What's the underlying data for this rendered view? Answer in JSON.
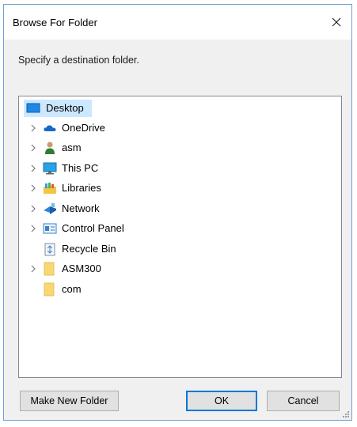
{
  "window": {
    "title": "Browse For Folder",
    "close_glyph": "✕"
  },
  "instruction": "Specify a destination folder.",
  "tree": {
    "items": [
      {
        "label": "Desktop",
        "icon": "desktop-icon",
        "expandable": false,
        "selected": true,
        "level": 0
      },
      {
        "label": "OneDrive",
        "icon": "onedrive-cloud-icon",
        "expandable": true,
        "level": 1
      },
      {
        "label": "asm",
        "icon": "user-icon",
        "expandable": true,
        "level": 1
      },
      {
        "label": "This PC",
        "icon": "computer-icon",
        "expandable": true,
        "level": 1
      },
      {
        "label": "Libraries",
        "icon": "libraries-icon",
        "expandable": true,
        "level": 1
      },
      {
        "label": "Network",
        "icon": "network-icon",
        "expandable": true,
        "level": 1
      },
      {
        "label": "Control Panel",
        "icon": "control-panel-icon",
        "expandable": true,
        "level": 1
      },
      {
        "label": "Recycle Bin",
        "icon": "recycle-bin-icon",
        "expandable": false,
        "level": 1
      },
      {
        "label": "ASM300",
        "icon": "folder-icon",
        "expandable": true,
        "level": 1
      },
      {
        "label": "com",
        "icon": "folder-icon",
        "expandable": false,
        "level": 1
      }
    ]
  },
  "buttons": {
    "make_new_folder": "Make New Folder",
    "ok": "OK",
    "cancel": "Cancel"
  },
  "colors": {
    "selection": "#cce8ff",
    "default_button_border": "#0078d7",
    "folder_yellow": "#f8d775"
  }
}
